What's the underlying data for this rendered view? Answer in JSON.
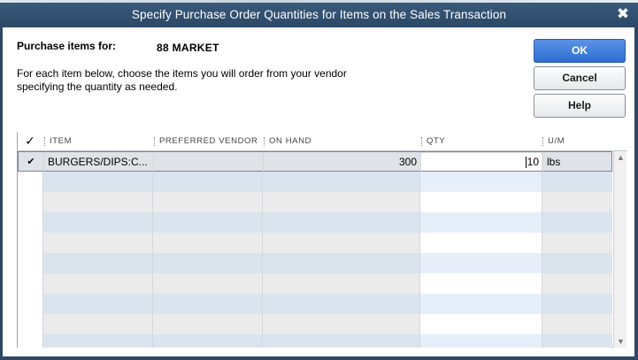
{
  "window": {
    "title": "Specify Purchase Order Quantities for Items on the Sales Transaction",
    "close_glyph": "✖"
  },
  "form": {
    "purchase_label": "Purchase items for:",
    "customer": "88 MARKET",
    "instructions": "For each item below, choose the items you will order from your vendor specifying the quantity as needed."
  },
  "buttons": {
    "ok": "OK",
    "cancel": "Cancel",
    "help": "Help"
  },
  "grid": {
    "columns": {
      "check": "✓",
      "item": "ITEM",
      "preferred_vendor": "PREFERRED VENDOR",
      "on_hand": "ON HAND",
      "qty": "QTY",
      "um": "U/M"
    },
    "rows": [
      {
        "check": "✔",
        "item": "BURGERS/DIPS:C...",
        "preferred_vendor": "",
        "on_hand": "300",
        "qty": "10",
        "um": "lbs"
      }
    ],
    "scroll_up": "▲",
    "scroll_down": "▼"
  },
  "colors": {
    "title_bar": "#2d4764",
    "primary_button": "#3a7bdc",
    "row_stripe_blue": "#dae4ef",
    "row_stripe_gray": "#ebebeb"
  }
}
